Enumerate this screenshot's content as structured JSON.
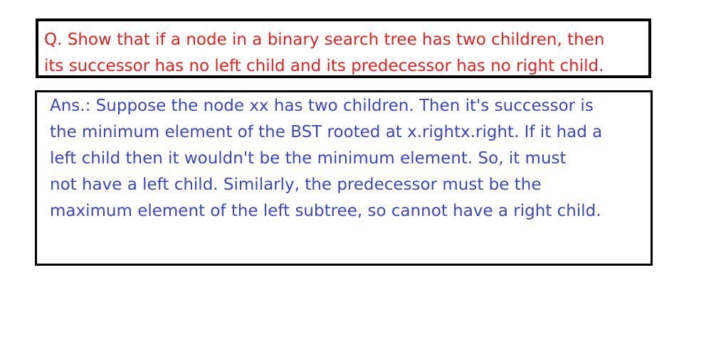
{
  "question": {
    "text": "Q. Show that if a node in a binary search tree has two children, then\nits successor has no left child and its predecessor has no right child.",
    "color": "#e8211f"
  },
  "answer": {
    "text": "Ans.: Suppose the node xx has two children. Then it's successor is\nthe minimum element of the BST rooted at x.rightx.right. If it had a\nleft child then it wouldn't be the minimum element. So, it must\nnot have a left child. Similarly, the predecessor must be the\nmaximum element of the left subtree, so cannot have a right child.",
    "color": "#3a46c6"
  }
}
